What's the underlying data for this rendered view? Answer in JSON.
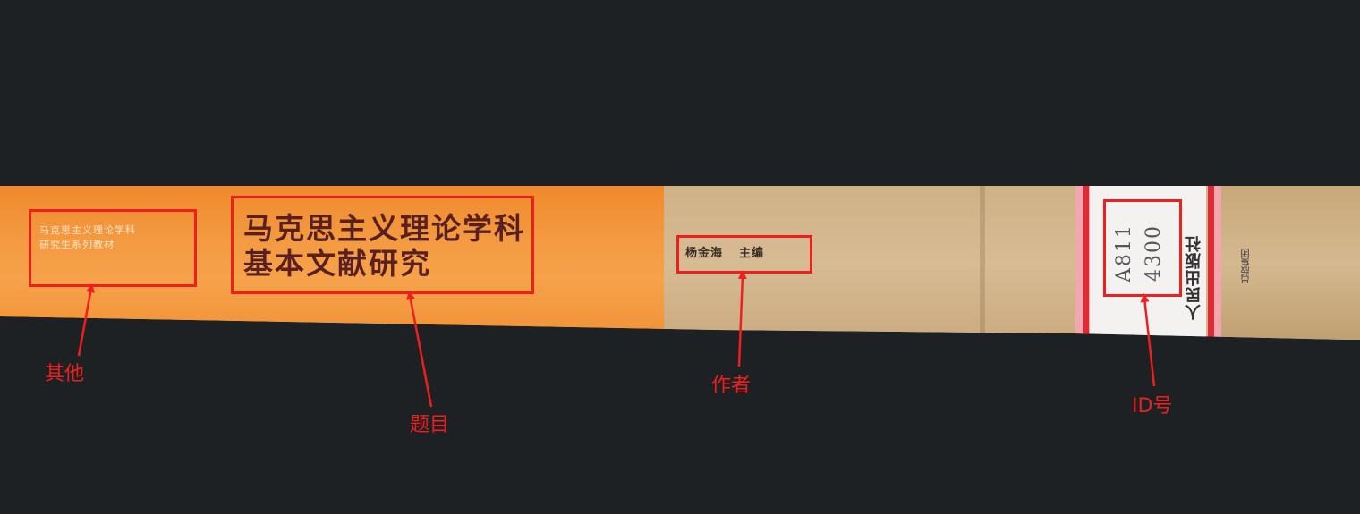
{
  "spine": {
    "other_lines": [
      "马克思主义理论学科",
      "研究生系列教材"
    ],
    "title_lines": [
      "马克思主义理论学科",
      "基本文献研究"
    ],
    "author_name": "杨金海",
    "author_role": "主编",
    "id_lines": [
      "A811",
      "4300"
    ],
    "publisher": "人民出版社",
    "press_text": "出版集团"
  },
  "annotations": {
    "other": "其他",
    "title": "题目",
    "author": "作者",
    "id": "ID号"
  },
  "colors": {
    "annotation": "#ee1f1f",
    "spine_orange": "#f39a42",
    "spine_tan": "#d7bb93",
    "background": "#1e2123"
  }
}
